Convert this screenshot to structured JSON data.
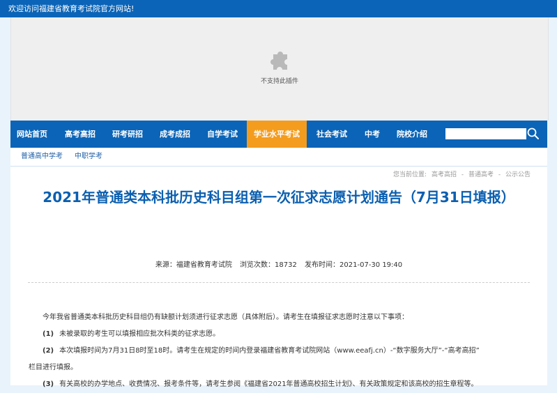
{
  "topbar": {
    "welcome": "欢迎访问福建省教育考试院官方网站!"
  },
  "plugin": {
    "icon": "puzzle-piece-icon",
    "message": "不支持此插件"
  },
  "nav": {
    "items": [
      "网站首页",
      "高考高招",
      "研考研招",
      "成考成招",
      "自学考试",
      "学业水平考试",
      "社会考试",
      "中考",
      "院校介绍"
    ],
    "active_index": 5,
    "search_placeholder": "",
    "search_icon": "search-icon"
  },
  "subnav": {
    "items": [
      "普通高中学考",
      "中职学考"
    ]
  },
  "breadcrumb": {
    "label": "您当前位置:",
    "sep": "-",
    "items": [
      "高考高招",
      "普通高考",
      "公示公告"
    ]
  },
  "article": {
    "title": "2021年普通类本科批历史科目组第一次征求志愿计划通告（7月31日填报）",
    "meta": {
      "source": "来源：福建省教育考试院",
      "views": "浏览次数：18732",
      "published": "发布时间：2021-07-30 19:40"
    },
    "intro": "今年我省普通类本科批历史科目组仍有缺额计划须进行征求志愿（具体附后）。请考生在填报征求志愿时注意以下事项：",
    "points": [
      {
        "num": "(1)",
        "text": "未被录取的考生可以填报相应批次科类的征求志愿。"
      },
      {
        "num": "(2)",
        "text": "本次填报时间为7月31日8时至18时。请考生在规定的时间内登录福建省教育考试院网站（www.eeafj.cn）-“数字服务大厅”-“高考高招”"
      },
      {
        "num": "",
        "text": "栏目进行填报。"
      },
      {
        "num": "(3)",
        "text": "有关高校的办学地点、收费情况、报考条件等，请考生参阅《福建省2021年普通高校招生计划》、有关政策规定和该高校的招生章程等。"
      }
    ]
  },
  "colors": {
    "primary": "#0b64b7",
    "active_tab": "#f39c1e",
    "title": "#0b5fb0"
  }
}
